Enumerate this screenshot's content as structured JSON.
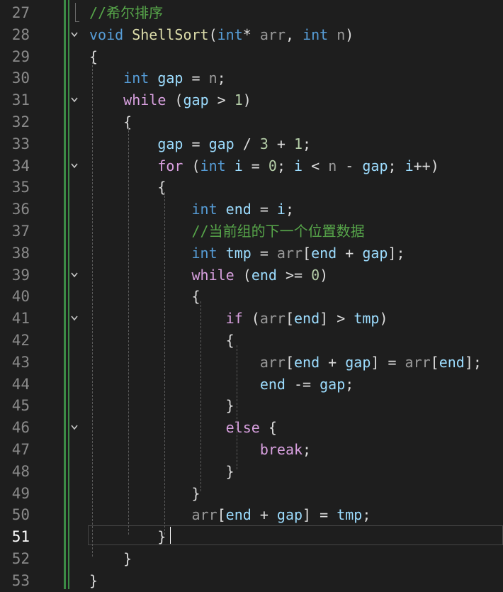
{
  "editor": {
    "active_line": "51",
    "lines": [
      {
        "no": "27",
        "tokens": [
          {
            "t": "//希尔排序",
            "c": "cm"
          }
        ]
      },
      {
        "no": "28",
        "fold": true,
        "tokens": [
          {
            "t": "void",
            "c": "kw"
          },
          {
            "t": " "
          },
          {
            "t": "ShellSort",
            "c": "fn"
          },
          {
            "t": "("
          },
          {
            "t": "int",
            "c": "kw"
          },
          {
            "t": "* "
          },
          {
            "t": "arr",
            "c": "param"
          },
          {
            "t": ", "
          },
          {
            "t": "int",
            "c": "kw"
          },
          {
            "t": " "
          },
          {
            "t": "n",
            "c": "param"
          },
          {
            "t": ")"
          }
        ]
      },
      {
        "no": "29",
        "tokens": [
          {
            "t": "{"
          }
        ]
      },
      {
        "no": "30",
        "tokens": [
          {
            "t": "    "
          },
          {
            "t": "int",
            "c": "kw"
          },
          {
            "t": " "
          },
          {
            "t": "gap",
            "c": "var"
          },
          {
            "t": " = "
          },
          {
            "t": "n",
            "c": "param"
          },
          {
            "t": ";"
          }
        ]
      },
      {
        "no": "31",
        "fold": true,
        "tokens": [
          {
            "t": "    "
          },
          {
            "t": "while",
            "c": "ctrl"
          },
          {
            "t": " ("
          },
          {
            "t": "gap",
            "c": "var"
          },
          {
            "t": " > "
          },
          {
            "t": "1",
            "c": "num"
          },
          {
            "t": ")"
          }
        ]
      },
      {
        "no": "32",
        "tokens": [
          {
            "t": "    {"
          }
        ]
      },
      {
        "no": "33",
        "tokens": [
          {
            "t": "        "
          },
          {
            "t": "gap",
            "c": "var"
          },
          {
            "t": " = "
          },
          {
            "t": "gap",
            "c": "var"
          },
          {
            "t": " / "
          },
          {
            "t": "3",
            "c": "num"
          },
          {
            "t": " + "
          },
          {
            "t": "1",
            "c": "num"
          },
          {
            "t": ";"
          }
        ]
      },
      {
        "no": "34",
        "fold": true,
        "tokens": [
          {
            "t": "        "
          },
          {
            "t": "for",
            "c": "ctrl"
          },
          {
            "t": " ("
          },
          {
            "t": "int",
            "c": "kw"
          },
          {
            "t": " "
          },
          {
            "t": "i",
            "c": "var"
          },
          {
            "t": " = "
          },
          {
            "t": "0",
            "c": "num"
          },
          {
            "t": "; "
          },
          {
            "t": "i",
            "c": "var"
          },
          {
            "t": " < "
          },
          {
            "t": "n",
            "c": "param"
          },
          {
            "t": " - "
          },
          {
            "t": "gap",
            "c": "var"
          },
          {
            "t": "; "
          },
          {
            "t": "i",
            "c": "var"
          },
          {
            "t": "++)"
          }
        ]
      },
      {
        "no": "35",
        "tokens": [
          {
            "t": "        {"
          }
        ]
      },
      {
        "no": "36",
        "tokens": [
          {
            "t": "            "
          },
          {
            "t": "int",
            "c": "kw"
          },
          {
            "t": " "
          },
          {
            "t": "end",
            "c": "var"
          },
          {
            "t": " = "
          },
          {
            "t": "i",
            "c": "var"
          },
          {
            "t": ";"
          }
        ]
      },
      {
        "no": "37",
        "tokens": [
          {
            "t": "            "
          },
          {
            "t": "//当前组的下一个位置数据",
            "c": "cm"
          }
        ]
      },
      {
        "no": "38",
        "tokens": [
          {
            "t": "            "
          },
          {
            "t": "int",
            "c": "kw"
          },
          {
            "t": " "
          },
          {
            "t": "tmp",
            "c": "var"
          },
          {
            "t": " = "
          },
          {
            "t": "arr",
            "c": "param"
          },
          {
            "t": "["
          },
          {
            "t": "end",
            "c": "var"
          },
          {
            "t": " + "
          },
          {
            "t": "gap",
            "c": "var"
          },
          {
            "t": "];"
          }
        ]
      },
      {
        "no": "39",
        "fold": true,
        "tokens": [
          {
            "t": "            "
          },
          {
            "t": "while",
            "c": "ctrl"
          },
          {
            "t": " ("
          },
          {
            "t": "end",
            "c": "var"
          },
          {
            "t": " >= "
          },
          {
            "t": "0",
            "c": "num"
          },
          {
            "t": ")"
          }
        ]
      },
      {
        "no": "40",
        "tokens": [
          {
            "t": "            {"
          }
        ]
      },
      {
        "no": "41",
        "fold": true,
        "tokens": [
          {
            "t": "                "
          },
          {
            "t": "if",
            "c": "ctrl"
          },
          {
            "t": " ("
          },
          {
            "t": "arr",
            "c": "param"
          },
          {
            "t": "["
          },
          {
            "t": "end",
            "c": "var"
          },
          {
            "t": "] > "
          },
          {
            "t": "tmp",
            "c": "var"
          },
          {
            "t": ")"
          }
        ]
      },
      {
        "no": "42",
        "tokens": [
          {
            "t": "                {"
          }
        ]
      },
      {
        "no": "43",
        "tokens": [
          {
            "t": "                    "
          },
          {
            "t": "arr",
            "c": "param"
          },
          {
            "t": "["
          },
          {
            "t": "end",
            "c": "var"
          },
          {
            "t": " + "
          },
          {
            "t": "gap",
            "c": "var"
          },
          {
            "t": "] = "
          },
          {
            "t": "arr",
            "c": "param"
          },
          {
            "t": "["
          },
          {
            "t": "end",
            "c": "var"
          },
          {
            "t": "];"
          }
        ]
      },
      {
        "no": "44",
        "tokens": [
          {
            "t": "                    "
          },
          {
            "t": "end",
            "c": "var"
          },
          {
            "t": " -= "
          },
          {
            "t": "gap",
            "c": "var"
          },
          {
            "t": ";"
          }
        ]
      },
      {
        "no": "45",
        "tokens": [
          {
            "t": "                }"
          }
        ]
      },
      {
        "no": "46",
        "fold": true,
        "tokens": [
          {
            "t": "                "
          },
          {
            "t": "else",
            "c": "ctrl"
          },
          {
            "t": " {"
          }
        ]
      },
      {
        "no": "47",
        "tokens": [
          {
            "t": "                    "
          },
          {
            "t": "break",
            "c": "ctrl"
          },
          {
            "t": ";"
          }
        ]
      },
      {
        "no": "48",
        "tokens": [
          {
            "t": "                }"
          }
        ]
      },
      {
        "no": "49",
        "tokens": [
          {
            "t": "            }"
          }
        ]
      },
      {
        "no": "50",
        "tokens": [
          {
            "t": "            "
          },
          {
            "t": "arr",
            "c": "param"
          },
          {
            "t": "["
          },
          {
            "t": "end",
            "c": "var"
          },
          {
            "t": " + "
          },
          {
            "t": "gap",
            "c": "var"
          },
          {
            "t": "] = "
          },
          {
            "t": "tmp",
            "c": "var"
          },
          {
            "t": ";"
          }
        ]
      },
      {
        "no": "51",
        "tokens": [
          {
            "t": "        }"
          }
        ]
      },
      {
        "no": "52",
        "tokens": [
          {
            "t": "    }"
          }
        ]
      },
      {
        "no": "53",
        "tokens": [
          {
            "t": "}"
          }
        ]
      }
    ]
  }
}
